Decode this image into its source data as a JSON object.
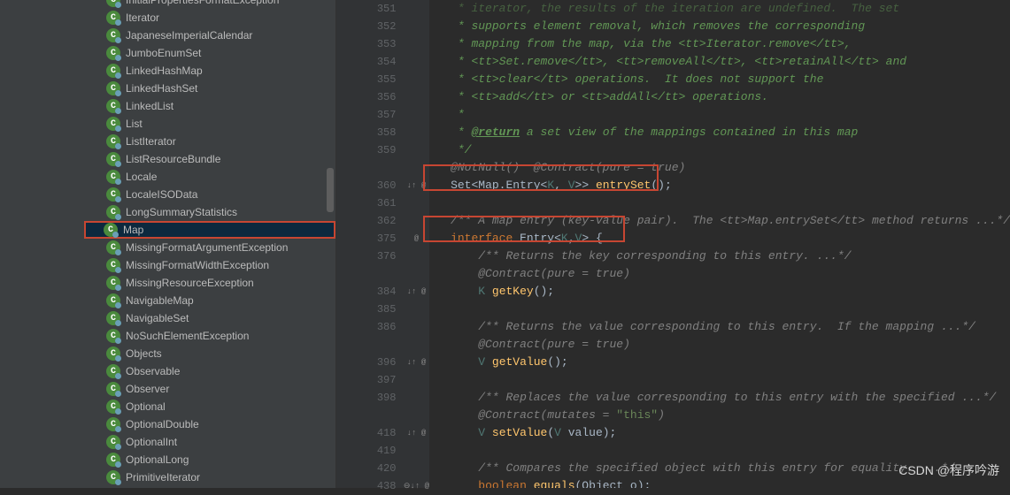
{
  "sidebar": {
    "items": [
      {
        "label": "InitialPropertiesFormatException",
        "partial": true
      },
      {
        "label": "Iterator"
      },
      {
        "label": "JapaneseImperialCalendar"
      },
      {
        "label": "JumboEnumSet"
      },
      {
        "label": "LinkedHashMap"
      },
      {
        "label": "LinkedHashSet"
      },
      {
        "label": "LinkedList"
      },
      {
        "label": "List"
      },
      {
        "label": "ListIterator"
      },
      {
        "label": "ListResourceBundle"
      },
      {
        "label": "Locale"
      },
      {
        "label": "LocaleISOData"
      },
      {
        "label": "LongSummaryStatistics"
      },
      {
        "label": "Map",
        "selected": true
      },
      {
        "label": "MissingFormatArgumentException"
      },
      {
        "label": "MissingFormatWidthException"
      },
      {
        "label": "MissingResourceException"
      },
      {
        "label": "NavigableMap"
      },
      {
        "label": "NavigableSet"
      },
      {
        "label": "NoSuchElementException"
      },
      {
        "label": "Objects"
      },
      {
        "label": "Observable"
      },
      {
        "label": "Observer"
      },
      {
        "label": "Optional"
      },
      {
        "label": "OptionalDouble"
      },
      {
        "label": "OptionalInt"
      },
      {
        "label": "OptionalLong"
      },
      {
        "label": "PrimitiveIterator"
      }
    ]
  },
  "gutter": {
    "lines": [
      "351",
      "352",
      "353",
      "354",
      "355",
      "356",
      "357",
      "358",
      "359",
      "",
      "360",
      "361",
      "362",
      "375",
      "376",
      "",
      "384",
      "385",
      "386",
      "",
      "396",
      "397",
      "398",
      "",
      "418",
      "419",
      "420",
      "438"
    ],
    "extras": [
      "",
      "",
      "",
      "",
      "",
      "",
      "",
      "",
      "",
      "",
      "↓↑ @",
      "",
      "",
      "@",
      "",
      "",
      "↓↑ @",
      "",
      "",
      "",
      "↓↑ @",
      "",
      "",
      "",
      "↓↑ @",
      "",
      "",
      "⊖↓↑ @"
    ]
  },
  "code": {
    "lines": [
      {
        "type": "doc",
        "text": "   * iterator, the results of the iteration are undefined.  The set",
        "faded": true
      },
      {
        "type": "doc",
        "text": "   * supports element removal, which removes the corresponding"
      },
      {
        "type": "doc",
        "parts": [
          {
            "t": "   * mapping from the map, via the ",
            "c": "doccomment"
          },
          {
            "t": "<tt>",
            "c": "tag"
          },
          {
            "t": "Iterator.remove",
            "c": "doccomment"
          },
          {
            "t": "</tt>",
            "c": "tag"
          },
          {
            "t": ",",
            "c": "doccomment"
          }
        ]
      },
      {
        "type": "doc",
        "parts": [
          {
            "t": "   * ",
            "c": "doccomment"
          },
          {
            "t": "<tt>",
            "c": "tag"
          },
          {
            "t": "Set.remove",
            "c": "doccomment"
          },
          {
            "t": "</tt>",
            "c": "tag"
          },
          {
            "t": ", ",
            "c": "doccomment"
          },
          {
            "t": "<tt>",
            "c": "tag"
          },
          {
            "t": "removeAll",
            "c": "doccomment"
          },
          {
            "t": "</tt>",
            "c": "tag"
          },
          {
            "t": ", ",
            "c": "doccomment"
          },
          {
            "t": "<tt>",
            "c": "tag"
          },
          {
            "t": "retainAll",
            "c": "doccomment"
          },
          {
            "t": "</tt>",
            "c": "tag"
          },
          {
            "t": " and",
            "c": "doccomment"
          }
        ]
      },
      {
        "type": "doc",
        "parts": [
          {
            "t": "   * ",
            "c": "doccomment"
          },
          {
            "t": "<tt>",
            "c": "tag"
          },
          {
            "t": "clear",
            "c": "doccomment"
          },
          {
            "t": "</tt>",
            "c": "tag"
          },
          {
            "t": " operations.  It does not support the",
            "c": "doccomment"
          }
        ]
      },
      {
        "type": "doc",
        "parts": [
          {
            "t": "   * ",
            "c": "doccomment"
          },
          {
            "t": "<tt>",
            "c": "tag"
          },
          {
            "t": "add",
            "c": "doccomment"
          },
          {
            "t": "</tt>",
            "c": "tag"
          },
          {
            "t": " or ",
            "c": "doccomment"
          },
          {
            "t": "<tt>",
            "c": "tag"
          },
          {
            "t": "addAll",
            "c": "doccomment"
          },
          {
            "t": "</tt>",
            "c": "tag"
          },
          {
            "t": " operations.",
            "c": "doccomment"
          }
        ]
      },
      {
        "type": "doc",
        "text": "   *"
      },
      {
        "type": "doc",
        "parts": [
          {
            "t": "   * ",
            "c": "doccomment"
          },
          {
            "t": "@return",
            "c": "docreturn"
          },
          {
            "t": " a set view of the mappings contained in this map",
            "c": "doccomment"
          }
        ]
      },
      {
        "type": "doc",
        "text": "   */"
      },
      {
        "type": "ann",
        "text": "  @NotNull()  @Contract(pure = true)"
      },
      {
        "type": "code",
        "parts": [
          {
            "t": "  ",
            "c": "punct"
          },
          {
            "t": "Set",
            "c": "type"
          },
          {
            "t": "<",
            "c": "punct"
          },
          {
            "t": "Map.Entry",
            "c": "type"
          },
          {
            "t": "<",
            "c": "punct"
          },
          {
            "t": "K",
            "c": "generic"
          },
          {
            "t": ", ",
            "c": "punct"
          },
          {
            "t": "V",
            "c": "generic"
          },
          {
            "t": ">> ",
            "c": "punct"
          },
          {
            "t": "entrySet",
            "c": "method"
          },
          {
            "t": "();",
            "c": "punct"
          }
        ],
        "highlight": 1
      },
      {
        "type": "blank",
        "text": ""
      },
      {
        "type": "doc",
        "parts": [
          {
            "t": "  /** A map entry (key-value pair).  The ",
            "c": "comment"
          },
          {
            "t": "<tt>",
            "c": "comment"
          },
          {
            "t": "Map.entrySet",
            "c": "comment"
          },
          {
            "t": "</tt>",
            "c": "comment"
          },
          {
            "t": " method returns ...*/",
            "c": "comment"
          }
        ]
      },
      {
        "type": "code",
        "parts": [
          {
            "t": "  ",
            "c": "punct"
          },
          {
            "t": "interface ",
            "c": "keyword"
          },
          {
            "t": "Entry",
            "c": "type"
          },
          {
            "t": "<",
            "c": "punct"
          },
          {
            "t": "K",
            "c": "generic"
          },
          {
            "t": ",",
            "c": "punct"
          },
          {
            "t": "V",
            "c": "generic"
          },
          {
            "t": "> {",
            "c": "punct"
          }
        ],
        "highlight": 2
      },
      {
        "type": "doc",
        "text": "      /** Returns the key corresponding to this entry. ...*/",
        "comment": true
      },
      {
        "type": "ann",
        "text": "      @Contract(pure = true)"
      },
      {
        "type": "code",
        "parts": [
          {
            "t": "      ",
            "c": "punct"
          },
          {
            "t": "K",
            "c": "generic"
          },
          {
            "t": " ",
            "c": "punct"
          },
          {
            "t": "getKey",
            "c": "method"
          },
          {
            "t": "();",
            "c": "punct"
          }
        ]
      },
      {
        "type": "blank",
        "text": ""
      },
      {
        "type": "doc",
        "text": "      /** Returns the value corresponding to this entry.  If the mapping ...*/",
        "comment": true
      },
      {
        "type": "ann",
        "text": "      @Contract(pure = true)"
      },
      {
        "type": "code",
        "parts": [
          {
            "t": "      ",
            "c": "punct"
          },
          {
            "t": "V",
            "c": "generic"
          },
          {
            "t": " ",
            "c": "punct"
          },
          {
            "t": "getValue",
            "c": "method"
          },
          {
            "t": "();",
            "c": "punct"
          }
        ]
      },
      {
        "type": "blank",
        "text": ""
      },
      {
        "type": "doc",
        "text": "      /** Replaces the value corresponding to this entry with the specified ...*/",
        "comment": true
      },
      {
        "type": "ann",
        "parts": [
          {
            "t": "      @Contract(mutates = ",
            "c": "comment"
          },
          {
            "t": "\"this\"",
            "c": "string"
          },
          {
            "t": ")",
            "c": "comment"
          }
        ]
      },
      {
        "type": "code",
        "parts": [
          {
            "t": "      ",
            "c": "punct"
          },
          {
            "t": "V",
            "c": "generic"
          },
          {
            "t": " ",
            "c": "punct"
          },
          {
            "t": "setValue",
            "c": "method"
          },
          {
            "t": "(",
            "c": "punct"
          },
          {
            "t": "V",
            "c": "generic"
          },
          {
            "t": " value);",
            "c": "punct"
          }
        ]
      },
      {
        "type": "blank",
        "text": ""
      },
      {
        "type": "doc",
        "text": "      /** Compares the specified object with this entry for equality. ...*/",
        "comment": true
      },
      {
        "type": "code",
        "parts": [
          {
            "t": "      ",
            "c": "punct"
          },
          {
            "t": "boolean ",
            "c": "keyword"
          },
          {
            "t": "equals",
            "c": "method"
          },
          {
            "t": "(Object o);",
            "c": "punct"
          }
        ]
      }
    ]
  },
  "watermark": "CSDN @程序吟游"
}
